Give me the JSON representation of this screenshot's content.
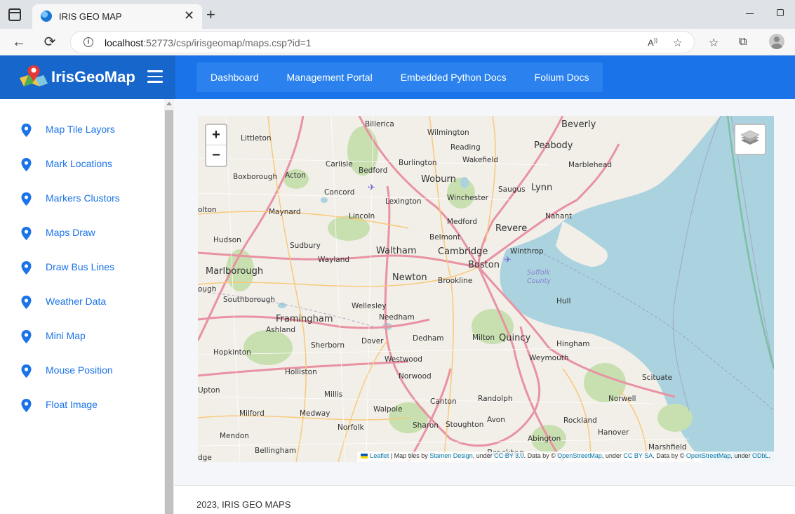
{
  "browser": {
    "tab_title": "IRIS GEO MAP",
    "tab_close": "✕",
    "new_tab": "+",
    "url_host": "localhost",
    "url_rest": ":52773/csp/irisgeomap/maps.csp?id=1",
    "back": "←",
    "reload": "⟳"
  },
  "header": {
    "brand": "IrisGeoMap",
    "nav": [
      "Dashboard",
      "Management Portal",
      "Embedded Python Docs",
      "Folium Docs"
    ]
  },
  "sidebar": {
    "items": [
      {
        "label": "Map Tile Layors"
      },
      {
        "label": "Mark Locations"
      },
      {
        "label": "Markers Clustors"
      },
      {
        "label": "Maps Draw"
      },
      {
        "label": "Draw Bus Lines"
      },
      {
        "label": "Weather Data"
      },
      {
        "label": "Mini Map"
      },
      {
        "label": "Mouse Position"
      },
      {
        "label": "Float Image"
      }
    ]
  },
  "map": {
    "zoom_in": "+",
    "zoom_out": "−",
    "attribution": {
      "leaflet": "Leaflet",
      "t1": " | Map tiles by ",
      "stamen": "Stamen Design",
      "t2": ", under ",
      "ccby": "CC BY 3.0",
      "t3": ". Data by © ",
      "osm1": "OpenStreetMap",
      "t4": ", under ",
      "ccbysa": "CC BY SA",
      "t5": ". Data by © ",
      "osm2": "OpenStreetMap",
      "t6": ", under ",
      "odbl": "ODbL",
      "t7": "."
    },
    "labels": [
      {
        "text": "Billerica"
      },
      {
        "text": "Wilmington"
      },
      {
        "text": "Beverly"
      },
      {
        "text": "Littleton"
      },
      {
        "text": "Carlisle"
      },
      {
        "text": "Reading"
      },
      {
        "text": "Peabody"
      },
      {
        "text": "Burlington"
      },
      {
        "text": "Wakefield"
      },
      {
        "text": "Marblehead"
      },
      {
        "text": "Bedford"
      },
      {
        "text": "Boxborough"
      },
      {
        "text": "Acton"
      },
      {
        "text": "Woburn"
      },
      {
        "text": "Saugus"
      },
      {
        "text": "Lynn"
      },
      {
        "text": "Concord"
      },
      {
        "text": "Winchester"
      },
      {
        "text": "Lexington"
      },
      {
        "text": "olton"
      },
      {
        "text": "Maynard"
      },
      {
        "text": "Lincoln"
      },
      {
        "text": "Nahant"
      },
      {
        "text": "Medford"
      },
      {
        "text": "Revere"
      },
      {
        "text": "Hudson"
      },
      {
        "text": "Belmont"
      },
      {
        "text": "Sudbury"
      },
      {
        "text": "Waltham"
      },
      {
        "text": "Cambridge"
      },
      {
        "text": "Winthrop"
      },
      {
        "text": "Wayland"
      },
      {
        "text": "Boston"
      },
      {
        "text": "Marlborough"
      },
      {
        "text": "Suffolk"
      },
      {
        "text": "County"
      },
      {
        "text": "Newton"
      },
      {
        "text": "Brookline"
      },
      {
        "text": "ough"
      },
      {
        "text": "Southborough"
      },
      {
        "text": "Hull"
      },
      {
        "text": "Wellesley"
      },
      {
        "text": "Needham"
      },
      {
        "text": "Framingham"
      },
      {
        "text": "Ashland"
      },
      {
        "text": "Milton"
      },
      {
        "text": "Quincy"
      },
      {
        "text": "Dedham"
      },
      {
        "text": "Dover"
      },
      {
        "text": "Hingham"
      },
      {
        "text": "Sherborn"
      },
      {
        "text": "Hopkinton"
      },
      {
        "text": "Weymouth"
      },
      {
        "text": "Westwood"
      },
      {
        "text": "Holliston"
      },
      {
        "text": "Norwood"
      },
      {
        "text": "Scituate"
      },
      {
        "text": "Upton"
      },
      {
        "text": "Millis"
      },
      {
        "text": "Canton"
      },
      {
        "text": "Randolph"
      },
      {
        "text": "Norwell"
      },
      {
        "text": "Walpole"
      },
      {
        "text": "Milford"
      },
      {
        "text": "Medway"
      },
      {
        "text": "Avon"
      },
      {
        "text": "Rockland"
      },
      {
        "text": "Sharon"
      },
      {
        "text": "Stoughton"
      },
      {
        "text": "Norfolk"
      },
      {
        "text": "Hanover"
      },
      {
        "text": "Mendon"
      },
      {
        "text": "Abington"
      },
      {
        "text": "Marshfield"
      },
      {
        "text": "Bellingham"
      },
      {
        "text": "Brockton"
      },
      {
        "text": "dge"
      }
    ]
  },
  "footer": {
    "text": "2023, IRIS GEO MAPS"
  },
  "colors": {
    "primary": "#1a73e8",
    "brand_bg": "#1766cc",
    "water": "#aad3df",
    "land": "#f2efe9",
    "park": "#c8dfb0",
    "highway": "#e892a2"
  }
}
